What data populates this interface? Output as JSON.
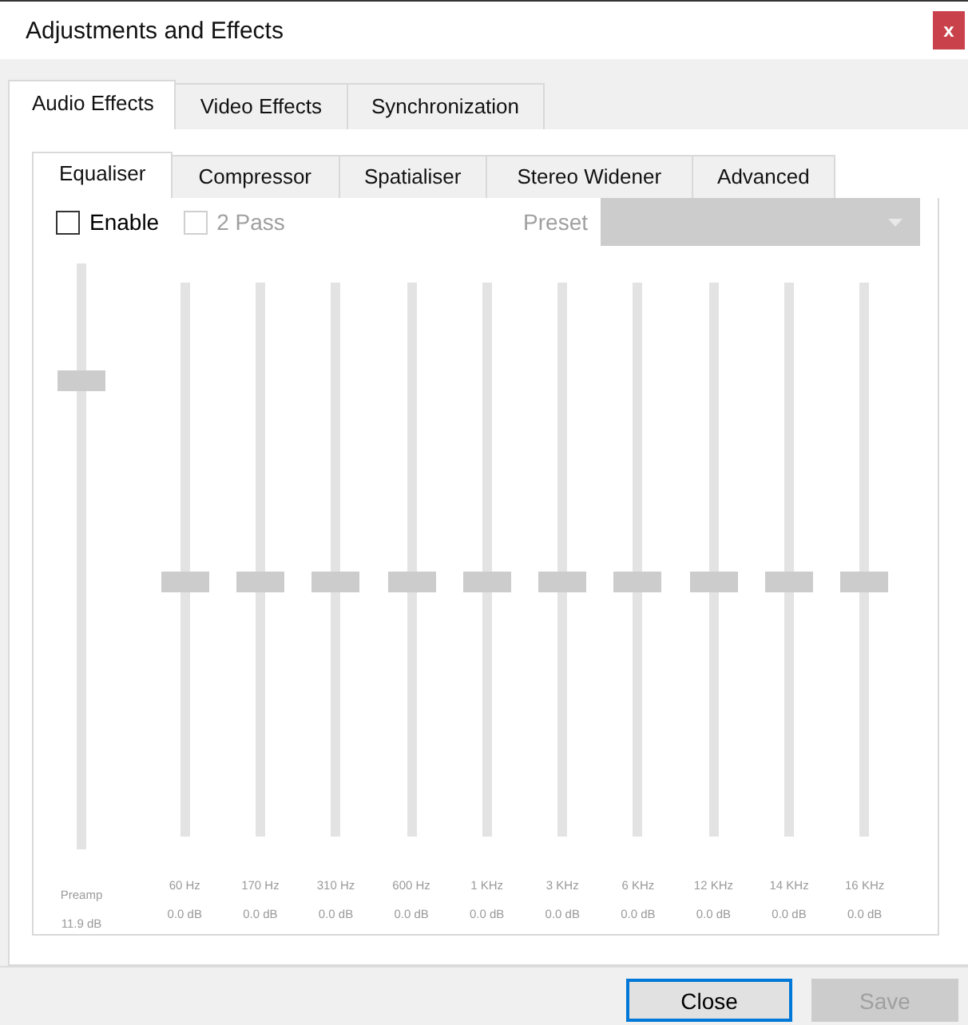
{
  "window": {
    "title": "Adjustments and Effects",
    "close_label": "x"
  },
  "tabs": [
    {
      "label": "Audio Effects",
      "selected": true
    },
    {
      "label": "Video Effects",
      "selected": false
    },
    {
      "label": "Synchronization",
      "selected": false
    }
  ],
  "subtabs": [
    {
      "label": "Equaliser",
      "selected": true
    },
    {
      "label": "Compressor",
      "selected": false
    },
    {
      "label": "Spatialiser",
      "selected": false
    },
    {
      "label": "Stereo Widener",
      "selected": false
    },
    {
      "label": "Advanced",
      "selected": false
    }
  ],
  "options": [
    {
      "label": "Enable",
      "checked": false,
      "disabled": false
    },
    {
      "label": "2 Pass",
      "checked": false,
      "disabled": true
    }
  ],
  "preset": {
    "label": "Preset",
    "disabled": true
  },
  "preamp": {
    "label": "Preamp",
    "reading": "11.9 dB",
    "level": 0.8
  },
  "bands": [
    {
      "label": "60 Hz",
      "reading": "0.0 dB",
      "level": 0.46
    },
    {
      "label": "170 Hz",
      "reading": "0.0 dB",
      "level": 0.46
    },
    {
      "label": "310 Hz",
      "reading": "0.0 dB",
      "level": 0.46
    },
    {
      "label": "600 Hz",
      "reading": "0.0 dB",
      "level": 0.46
    },
    {
      "label": "1 KHz",
      "reading": "0.0 dB",
      "level": 0.46
    },
    {
      "label": "3 KHz",
      "reading": "0.0 dB",
      "level": 0.46
    },
    {
      "label": "6 KHz",
      "reading": "0.0 dB",
      "level": 0.46
    },
    {
      "label": "12 KHz",
      "reading": "0.0 dB",
      "level": 0.46
    },
    {
      "label": "14 KHz",
      "reading": "0.0 dB",
      "level": 0.46
    },
    {
      "label": "16 KHz",
      "reading": "0.0 dB",
      "level": 0.46
    }
  ],
  "buttons": [
    {
      "label": "Close",
      "default": true,
      "disabled": false
    },
    {
      "label": "Save",
      "default": false,
      "disabled": true
    }
  ]
}
